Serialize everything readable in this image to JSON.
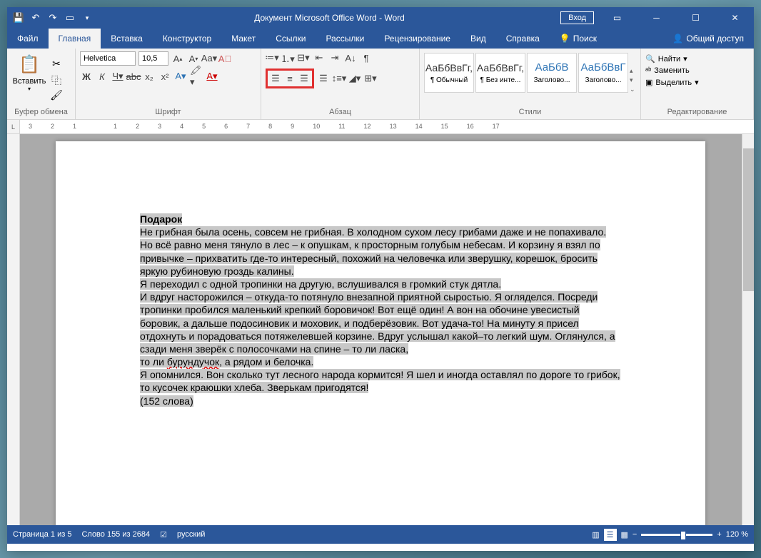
{
  "title": "Документ Microsoft Office Word  -  Word",
  "login": "Вход",
  "tabs": [
    "Файл",
    "Главная",
    "Вставка",
    "Конструктор",
    "Макет",
    "Ссылки",
    "Рассылки",
    "Рецензирование",
    "Вид",
    "Справка"
  ],
  "active_tab": 1,
  "search_label": "Поиск",
  "share": "Общий доступ",
  "clipboard": {
    "paste": "Вставить",
    "label": "Буфер обмена"
  },
  "font": {
    "name": "Helvetica",
    "size": "10,5",
    "label": "Шрифт"
  },
  "para": {
    "label": "Абзац"
  },
  "styles": {
    "label": "Стили",
    "items": [
      {
        "preview": "АаБбВвГг,",
        "name": "¶ Обычный"
      },
      {
        "preview": "АаБбВвГг,",
        "name": "¶ Без инте..."
      },
      {
        "preview": "АаБбВ",
        "name": "Заголово...",
        "blue": true
      },
      {
        "preview": "АаБбВвГ",
        "name": "Заголово...",
        "blue": true
      }
    ]
  },
  "editing": {
    "label": "Редактирование",
    "find": "Найти",
    "replace": "Заменить",
    "select": "Выделить"
  },
  "ruler": [
    "3",
    "2",
    "1",
    "",
    "1",
    "2",
    "3",
    "4",
    "5",
    "6",
    "7",
    "8",
    "9",
    "10",
    "11",
    "12",
    "13",
    "14",
    "15",
    "16",
    "17"
  ],
  "document": {
    "title": "Подарок",
    "p1a": "Не грибная была осень, совсем не грибная. В холодном сухом лесу грибами даже и не попахивало. Но всё равно меня тянуло в лес – к опушкам, к просторным голубым небесам. И корзину я взял по привычке – прихватить где-то интересный, похожий на человечка или зверушку, корешок, бросить яркую рубиновую гроздь калины.",
    "p2": "Я переходил с одной тропинки на другую, вслушивался в громкий стук дятла.",
    "p3a": "И вдруг насторожился – откуда-то потянуло внезапной приятной сыростью. Я огляделся. Посреди тропинки пробился маленький крепкий боровичок! Вот ещё один! А вон на обочине увесистый боровик, а дальше подосиновик и моховик, и подберёзовик. Вот удача-то! На минуту я присел отдохнуть и порадоваться потяжелевшей корзине. Вдруг услышал какой–то легкий шум. Оглянулся, а сзади меня зверёк с полосочками на спине – то ли ласка,",
    "p3b": "то ли ",
    "p3c": "бурундучок",
    "p3d": ", а рядом и белочка.",
    "p4": "Я опомнился. Вон сколько тут лесного народа кормится! Я шел и иногда оставлял по дороге то грибок, то кусочек краюшки хлеба. Зверькам пригодятся!",
    "p5": "(152 слова)"
  },
  "status": {
    "page": "Страница 1 из 5",
    "words": "Слово 155 из 2684",
    "lang": "русский",
    "zoom": "120 %"
  }
}
